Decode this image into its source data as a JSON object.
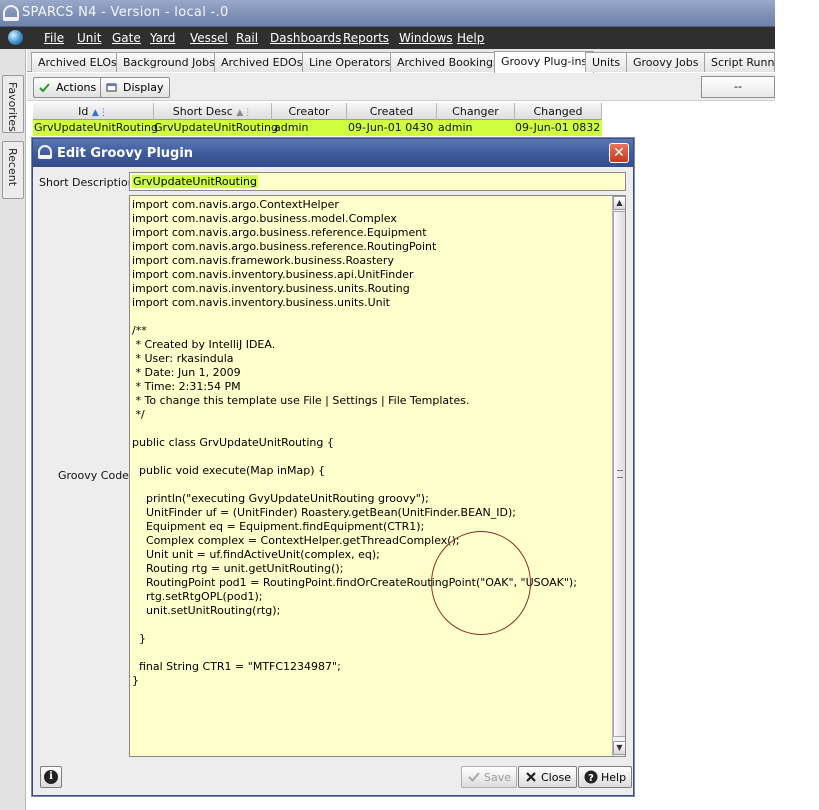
{
  "window": {
    "title": "SPARCS N4 - Version - local -.0"
  },
  "menu": [
    "File",
    "Unit",
    "Gate",
    "Yard",
    "Vessel",
    "Rail",
    "Dashboards",
    "Reports",
    "Windows",
    "Help"
  ],
  "dock_tabs": [
    "Favorites",
    "Recent"
  ],
  "tabs": [
    "Archived ELOs",
    "Background Jobs",
    "Archived EDOs",
    "Line Operators",
    "Archived Bookings",
    "Groovy Plug-ins",
    "Units",
    "Groovy Jobs",
    "Script Runner"
  ],
  "active_tab": "Groovy Plug-ins",
  "toolbar": {
    "actions_label": "Actions",
    "display_label": "Display",
    "dropdown_value": "--"
  },
  "table": {
    "columns": [
      "Id",
      "Short Desc",
      "Creator",
      "Created",
      "Changer",
      "Changed"
    ],
    "row": [
      "GrvUpdateUnitRouting",
      "GrvUpdateUnitRouting",
      "admin",
      "09-Jun-01 0430",
      "admin",
      "09-Jun-01 0832"
    ]
  },
  "dialog": {
    "title": "Edit Groovy Plugin",
    "short_desc_label": "Short Description:",
    "short_desc_value": "GrvUpdateUnitRouting",
    "code_label": "Groovy Code:",
    "code_lines": [
      "import com.navis.argo.ContextHelper",
      "import com.navis.argo.business.model.Complex",
      "import com.navis.argo.business.reference.Equipment",
      "import com.navis.argo.business.reference.RoutingPoint",
      "import com.navis.framework.business.Roastery",
      "import com.navis.inventory.business.api.UnitFinder",
      "import com.navis.inventory.business.units.Routing",
      "import com.navis.inventory.business.units.Unit",
      "",
      "/**",
      " * Created by IntelliJ IDEA.",
      " * User: rkasindula",
      " * Date: Jun 1, 2009",
      " * Time: 2:31:54 PM",
      " * To change this template use File | Settings | File Templates.",
      " */",
      "",
      "public class GrvUpdateUnitRouting {",
      "",
      "  public void execute(Map inMap) {",
      "",
      "    println(\"executing GvyUpdateUnitRouting groovy\");",
      "    UnitFinder uf = (UnitFinder) Roastery.getBean(UnitFinder.BEAN_ID);",
      "    Equipment eq = Equipment.findEquipment(CTR1);",
      "    Complex complex = ContextHelper.getThreadComplex();",
      "    Unit unit = uf.findActiveUnit(complex, eq);",
      "    Routing rtg = unit.getUnitRouting();",
      "    RoutingPoint pod1 = RoutingPoint.findOrCreateRoutingPoint(\"OAK\", \"USOAK\");",
      "    rtg.setRtgOPL(pod1);",
      "    unit.setUnitRouting(rtg);",
      "",
      "  }",
      "",
      "  final String CTR1 = \"MTFC1234987\";",
      "}"
    ],
    "buttons": {
      "save": "Save",
      "close": "Close",
      "help": "Help"
    }
  }
}
